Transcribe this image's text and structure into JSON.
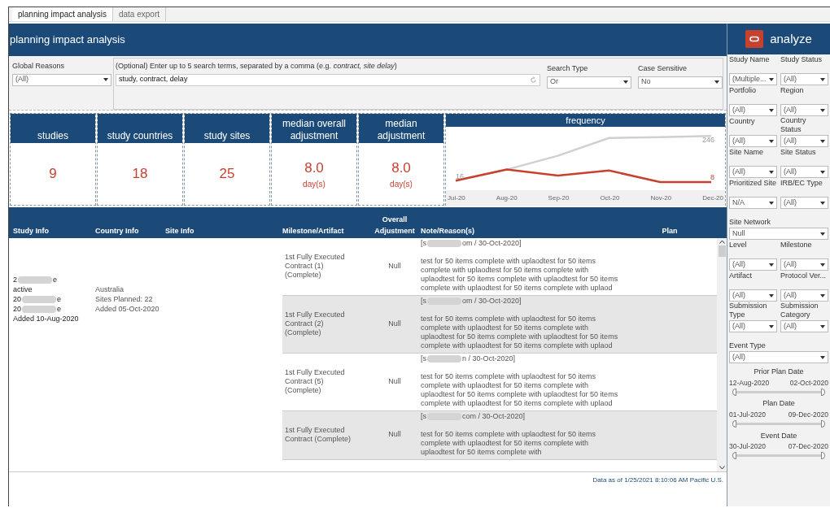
{
  "tabs": [
    {
      "label": "planning impact analysis",
      "selected": true
    },
    {
      "label": "data export",
      "selected": false
    }
  ],
  "header": {
    "title": "planning impact analysis"
  },
  "logo": {
    "text": "analyze"
  },
  "filters": {
    "global_reasons": {
      "label": "Global Reasons",
      "value": "(All)"
    },
    "search": {
      "label": "(Optional) Enter up to 5 search terms, separated by a comma (e.g. *contract, site delay*)",
      "value": "study, contract, delay"
    },
    "search_type": {
      "label": "Search Type",
      "value": "Or"
    },
    "case_sensitive": {
      "label": "Case Sensitive",
      "value": "No"
    }
  },
  "kpis": [
    {
      "label": "studies",
      "value": "9"
    },
    {
      "label": "study countries",
      "value": "18"
    },
    {
      "label": "study sites",
      "value": "25"
    },
    {
      "label": "median overall adjustment",
      "value": "8.0",
      "unit": "day(s)"
    },
    {
      "label": "median adjustment",
      "value": "8.0",
      "unit": "day(s)"
    }
  ],
  "frequency": {
    "title": "frequency",
    "chart_data": {
      "type": "line",
      "categories": [
        "Jul-20",
        "Aug-20",
        "Sep-20",
        "Oct-20",
        "Nov-20",
        "Dec-20"
      ],
      "series": [
        {
          "color": "#d0d0d0",
          "values": [
            16,
            73,
            144,
            236,
            240,
            246
          ],
          "value_labels": [
            "16",
            null,
            null,
            null,
            null,
            "246"
          ]
        },
        {
          "color": "#c8412f",
          "values": [
            16,
            73,
            42,
            68,
            8,
            8
          ],
          "value_labels": [
            null,
            null,
            null,
            null,
            null,
            "8"
          ]
        }
      ]
    }
  },
  "table": {
    "columns": [
      "Study Info",
      "Country Info",
      "Site Info",
      "Milestone/Artifact",
      "Overall Adjustment",
      "Note/Reason(s)",
      "Plan"
    ],
    "study_info": [
      {
        "text": "2",
        "redacted": true,
        "after": "e"
      },
      {
        "text": "active",
        "redacted": false
      },
      {
        "text": "20",
        "redacted": true,
        "after": "e"
      },
      {
        "text": "20",
        "redacted": true,
        "after": "e"
      },
      {
        "text": "Added 10-Aug-2020",
        "redacted": false
      }
    ],
    "country_info": [
      "Australia",
      "Sites Planned: 22",
      "Added 05-Oct-2020"
    ],
    "rows": [
      {
        "milestone": "1st Fully Executed Contract (1) (Complete)",
        "adjustment": "Null",
        "author": "[s",
        "author_end": "om / 30-Oct-2020]",
        "note": "test for 50 items complete with uplaodtest for 50 items complete with uplaodtest for 50 items complete with uplaodtest for 50 items complete with uplaodtest for 50 items complete with uplaodtest for 50 items complete with uplaod",
        "shaded": false
      },
      {
        "milestone": "1st Fully Executed Contract (2) (Complete)",
        "adjustment": "Null",
        "author": "[s",
        "author_end": "om / 30-Oct-2020]",
        "note": "test for 50 items complete with uplaodtest for 50 items complete with uplaodtest for 50 items complete with uplaodtest for 50 items complete with uplaodtest for 50 items complete with uplaodtest for 50 items complete with uplaod",
        "shaded": true
      },
      {
        "milestone": "1st Fully Executed Contract (5) (Complete)",
        "adjustment": "Null",
        "author": "[s",
        "author_end": "n / 30-Oct-2020]",
        "note": "test for 50 items complete with uplaodtest for 50 items complete with uplaodtest for 50 items complete with uplaodtest for 50 items complete with uplaodtest for 50 items complete with uplaodtest for 50 items complete with uplaod",
        "shaded": false
      },
      {
        "milestone": "1st Fully Executed Contract (Complete)",
        "adjustment": "Null",
        "author": "[s",
        "author_end": "com / 30-Oct-2020]",
        "note": "test for 50 items complete with uplaodtest for 50 items complete with uplaodtest for 50 items complete with uplaodtest for 50 items complete with",
        "shaded": true
      }
    ]
  },
  "footer": {
    "text": "Data as of 1/25/2021 8:10:06 AM Pacific U.S."
  },
  "sidebar": {
    "filters": [
      {
        "kind": "dropdown",
        "label": "Study Name",
        "value": "(Multiple..."
      },
      {
        "kind": "dropdown",
        "label": "Study Status",
        "value": "(All)"
      },
      {
        "kind": "dropdown",
        "label": "Portfolio",
        "value": "(All)"
      },
      {
        "kind": "dropdown",
        "label": "Region",
        "value": "(All)"
      },
      {
        "kind": "dropdown",
        "label": "Country",
        "value": "(All)"
      },
      {
        "kind": "dropdown",
        "label": "Country Status",
        "value": "(All)"
      },
      {
        "kind": "dropdown",
        "label": "Site Name",
        "value": "(All)"
      },
      {
        "kind": "dropdown",
        "label": "Site Status",
        "value": "(All)"
      },
      {
        "kind": "dropdown",
        "label": "Prioritized Site",
        "value": "N/A"
      },
      {
        "kind": "dropdown",
        "label": "IRB/EC Type",
        "value": "(All)"
      },
      {
        "kind": "wide",
        "label": "Site Network",
        "value": "Null"
      },
      {
        "kind": "dropdown",
        "label": "Level",
        "value": "(All)"
      },
      {
        "kind": "dropdown",
        "label": "Milestone",
        "value": "(All)"
      },
      {
        "kind": "dropdown",
        "label": "Artifact",
        "value": "(All)"
      },
      {
        "kind": "dropdown",
        "label": "Protocol Ver...",
        "value": "(All)"
      },
      {
        "kind": "dropdown",
        "label": "Submission Type",
        "value": "(All)"
      },
      {
        "kind": "dropdown",
        "label": "Submission Category",
        "value": "(All)"
      },
      {
        "kind": "wide",
        "label": "Event Type",
        "value": "(All)"
      },
      {
        "kind": "range",
        "label": "Prior Plan Date",
        "start": "12-Aug-2020",
        "end": "02-Oct-2020",
        "handles": [
          {
            "level": 0
          },
          {
            "level": 1
          }
        ]
      },
      {
        "kind": "range",
        "label": "Plan Date",
        "start": "01-Jul-2020",
        "end": "09-Dec-2020",
        "handles": [
          {
            "level": 0
          },
          {
            "level": 1
          }
        ]
      },
      {
        "kind": "range",
        "label": "Event Date",
        "start": "30-Jul-2020",
        "end": "07-Dec-2020",
        "handles": [
          {
            "level": 0
          },
          {
            "level": 1
          }
        ]
      }
    ]
  }
}
